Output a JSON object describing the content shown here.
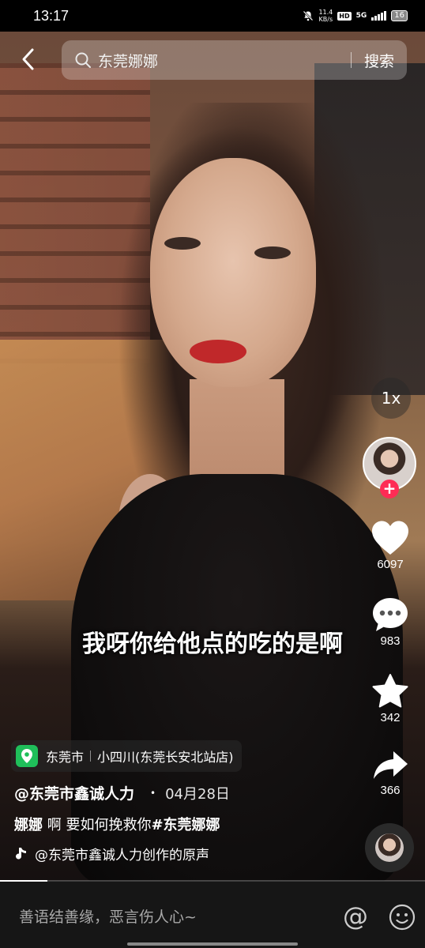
{
  "status_bar": {
    "time": "13:17",
    "net_speed": "11.4",
    "net_unit": "KB/s",
    "hd": "HD",
    "network": "5G",
    "battery": "16"
  },
  "search": {
    "query": "东莞娜娜",
    "button_label": "搜索"
  },
  "video": {
    "subtitle": "我呀你给他点的吃的是啊"
  },
  "right_rail": {
    "speed": "1x",
    "follow": "+",
    "likes": "6097",
    "comments": "983",
    "favorites": "342",
    "shares": "366"
  },
  "location": {
    "city": "东莞市",
    "place": "小四川(东莞长安北站店)"
  },
  "post": {
    "author": "@东莞市鑫诚人力",
    "dot": "•",
    "date": "04月28日",
    "caption_mention": "娜娜",
    "caption_text": " 啊 要如何挽救你",
    "caption_hashtag": "#东莞娜娜",
    "music": "@东莞市鑫诚人力创作的原声"
  },
  "comment_bar": {
    "placeholder": "善语结善缘，恶言伤人心~",
    "at": "@"
  },
  "colors": {
    "accent": "#fe2c55",
    "location_green": "#1fbf5a"
  }
}
